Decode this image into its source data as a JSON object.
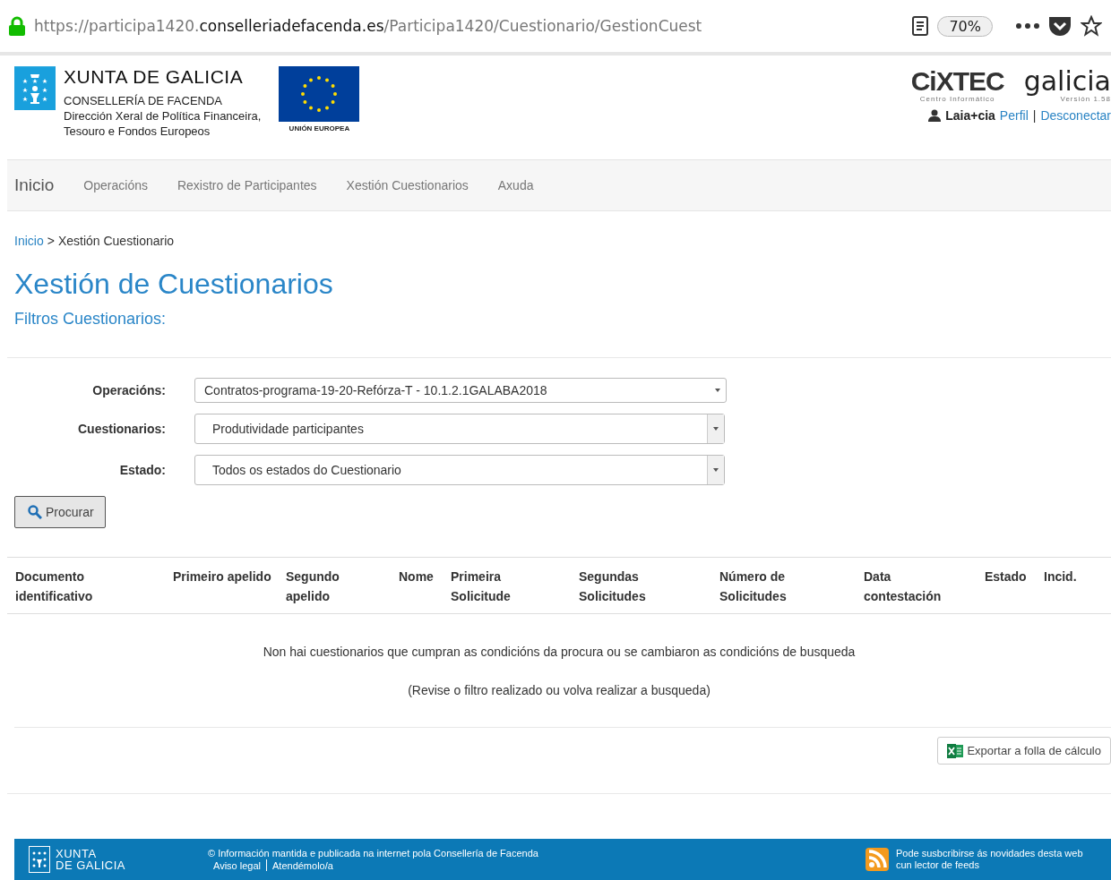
{
  "browser": {
    "url_prefix": "https://participa1420.",
    "url_domain": "conselleriadefacenda.es",
    "url_path": "/Participa1420/Cuestionario/GestionCuest",
    "zoom": "70%"
  },
  "header": {
    "org_title": "XUNTA DE GALICIA",
    "org_lines": [
      "CONSELLERÍA DE FACENDA",
      "Dirección Xeral de Política Financeira,",
      "Tesouro e Fondos Europeos"
    ],
    "eu_label": "UNIÓN EUROPEA",
    "cixtec_logo": "CiXTEC",
    "cixtec_subtitle": "Centro Informático",
    "galicia_logo": "galicia",
    "version": "Versión 1.58",
    "user": "Laia+cia",
    "user_links": [
      "Perfil",
      "Desconectar"
    ],
    "link_separator": "|"
  },
  "nav": [
    {
      "label": "Inicio",
      "selected": true
    },
    {
      "label": "Operacións",
      "selected": false
    },
    {
      "label": "Rexistro de Participantes",
      "selected": false
    },
    {
      "label": "Xestión Cuestionarios",
      "selected": false
    },
    {
      "label": "Axuda",
      "selected": false
    }
  ],
  "breadcrumb": {
    "link": "Inicio",
    "separator": ">",
    "current": "Xestión Cuestionario"
  },
  "title": "Xestión de Cuestionarios",
  "subtitle": "Filtros Cuestionarios:",
  "filters": [
    {
      "label": "Operacións:",
      "value": "Contratos-programa-19-20-Refórza-T - 10.1.2.1GALABA2018",
      "kind": "combo"
    },
    {
      "label": "Cuestionarios:",
      "value": "Produtividade participantes",
      "kind": "select"
    },
    {
      "label": "Estado:",
      "value": "Todos os estados do Cuestionario",
      "kind": "select"
    }
  ],
  "search_button": "Procurar",
  "table": {
    "columns": [
      "Documento identificativo",
      "Primeiro apelido",
      "Segundo apelido",
      "Nome",
      "Primeira Solicitude",
      "Segundas Solicitudes",
      "Número de Solicitudes",
      "Data contestación",
      "Estado",
      "Incid."
    ],
    "empty_messages": [
      "Non hai cuestionarios que cumpran as condicións da procura ou se cambiaron as condicións de busqueda",
      "(Revise o filtro realizado ou volva realizar a busqueda)"
    ]
  },
  "export_button": "Exportar a folla de cálculo",
  "footer": {
    "logo_lines": [
      "XUNTA",
      "DE GALICIA"
    ],
    "notice": "© Información mantida e publicada na internet pola Consellería de Facenda",
    "links": [
      "Aviso legal",
      "Atendémolo/a"
    ],
    "rss": "Pode susbcribirse ás novidades desta web cun lector de feeds"
  }
}
